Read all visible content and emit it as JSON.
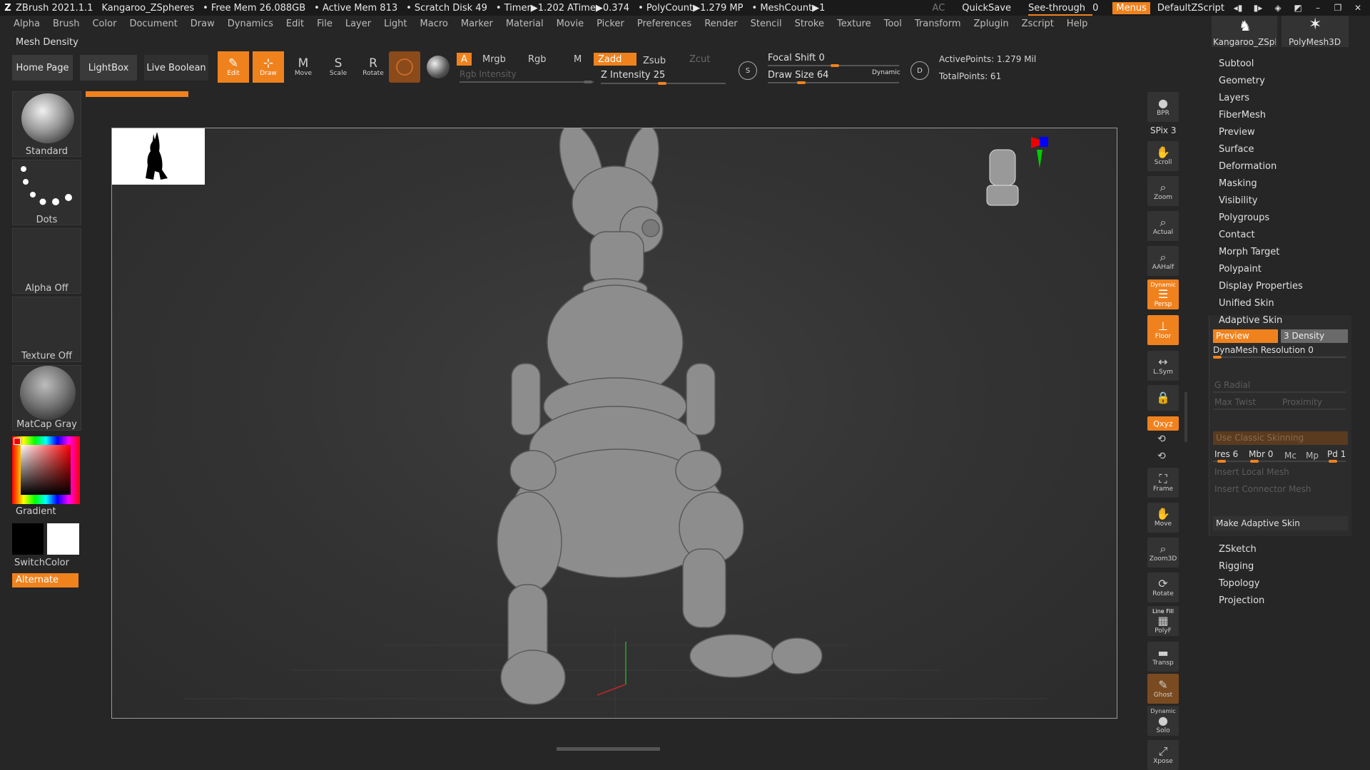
{
  "titlebar": {
    "app": "ZBrush 2021.1.1",
    "document": "Kangaroo_ZSpheres",
    "free_mem": "• Free Mem 26.088GB",
    "active_mem": "• Active Mem 813",
    "scratch": "• Scratch Disk 49",
    "timer": "• Timer▶1.202 ATime▶0.374",
    "polycount": "• PolyCount▶1.279 MP",
    "meshcount": "• MeshCount▶1",
    "ac": "AC",
    "quicksave": "QuickSave",
    "see_through": "See-through",
    "see_through_value": "0",
    "menus": "Menus",
    "default_zscript": "DefaultZScript"
  },
  "menubar": [
    "Alpha",
    "Brush",
    "Color",
    "Document",
    "Draw",
    "Dynamics",
    "Edit",
    "File",
    "Layer",
    "Light",
    "Macro",
    "Marker",
    "Material",
    "Movie",
    "Picker",
    "Preferences",
    "Render",
    "Stencil",
    "Stroke",
    "Texture",
    "Tool",
    "Transform",
    "Zplugin",
    "Zscript",
    "Help"
  ],
  "subtitle": "Mesh Density",
  "toolbar": {
    "home_page": "Home Page",
    "lightbox": "LightBox",
    "live_boolean": "Live Boolean",
    "edit": "Edit",
    "draw": "Draw",
    "move": "Move",
    "scale": "Scale",
    "rotate": "Rotate",
    "a": "A",
    "mrgb": "Mrgb",
    "rgb": "Rgb",
    "m": "M",
    "zadd": "Zadd",
    "zsub": "Zsub",
    "zcut": "Zcut",
    "rgb_intensity": "Rgb Intensity",
    "z_intensity": "Z Intensity 25",
    "focal_shift": "Focal Shift 0",
    "draw_size": "Draw Size 64",
    "dynamic": "Dynamic",
    "active_points": "ActivePoints: 1.279 Mil",
    "total_points": "TotalPoints: 61",
    "s": "S",
    "d": "D"
  },
  "left": {
    "standard": "Standard",
    "dots": "Dots",
    "alpha_off": "Alpha Off",
    "texture_off": "Texture Off",
    "matcap": "MatCap Gray",
    "gradient": "Gradient",
    "switchcolor": "SwitchColor",
    "alternate": "Alternate"
  },
  "shelf": {
    "bpr": "BPR",
    "spix": "SPix 3",
    "scroll": "Scroll",
    "zoom": "Zoom",
    "actual": "Actual",
    "aahalf": "AAHalf",
    "dynamic": "Dynamic",
    "persp": "Persp",
    "floor": "Floor",
    "lsym": "L.Sym",
    "xyz": "Qxyz",
    "frame": "Frame",
    "move": "Move",
    "zoom3d": "Zoom3D",
    "rotate": "Rotate",
    "linefill": "Line Fill",
    "polyf": "PolyF",
    "transp": "Transp",
    "ghost": "Ghost",
    "dynamic2": "Dynamic",
    "solo": "Solo",
    "xpose": "Xpose"
  },
  "tool_thumbs": {
    "left": "Kangaroo_ZSphe",
    "right": "PolyMesh3D"
  },
  "tool_palette": [
    "Subtool",
    "Geometry",
    "Layers",
    "FiberMesh",
    "Preview",
    "Surface",
    "Deformation",
    "Masking",
    "Visibility",
    "Polygroups",
    "Contact",
    "Morph Target",
    "Polypaint",
    "Display Properties",
    "Unified Skin"
  ],
  "adaptive": {
    "title": "Adaptive Skin",
    "preview": "Preview",
    "density": "3 Density",
    "dynamesh_res": "DynaMesh Resolution 0",
    "g_radial": "G Radial",
    "max_twist": "Max Twist",
    "proximity": "Proximity",
    "classic": "Use Classic Skinning",
    "ires": "Ires 6",
    "mbr": "Mbr 0",
    "mc": "Mc",
    "mp": "Mp",
    "pd": "Pd 1",
    "insert_local": "Insert Local Mesh",
    "insert_connector": "Insert Connector Mesh",
    "make": "Make Adaptive Skin"
  },
  "tool_palette_bottom": [
    "ZSketch",
    "Rigging",
    "Topology",
    "Projection"
  ],
  "colors": {
    "accent": "#f0821e",
    "panel": "#2f2f2f",
    "background": "#262626"
  }
}
